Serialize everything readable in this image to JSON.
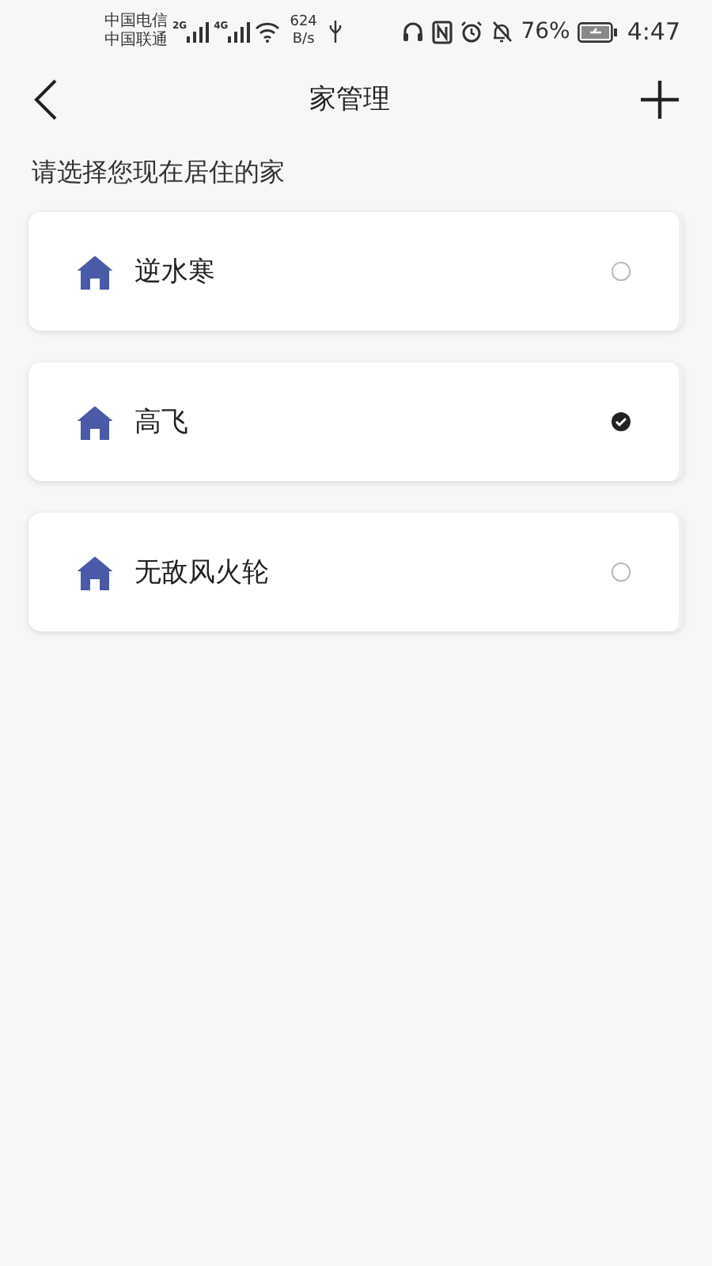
{
  "status_bar": {
    "carriers": [
      "中国电信",
      "中国联通"
    ],
    "networks": [
      "2G",
      "4G"
    ],
    "speed": [
      "624",
      "B/s"
    ],
    "battery": "76%",
    "time": "4:47"
  },
  "header": {
    "title": "家管理"
  },
  "prompt": "请选择您现在居住的家",
  "homes": [
    {
      "name": "逆水寒",
      "selected": false
    },
    {
      "name": "高飞",
      "selected": true
    },
    {
      "name": "无敌风火轮",
      "selected": false
    }
  ]
}
